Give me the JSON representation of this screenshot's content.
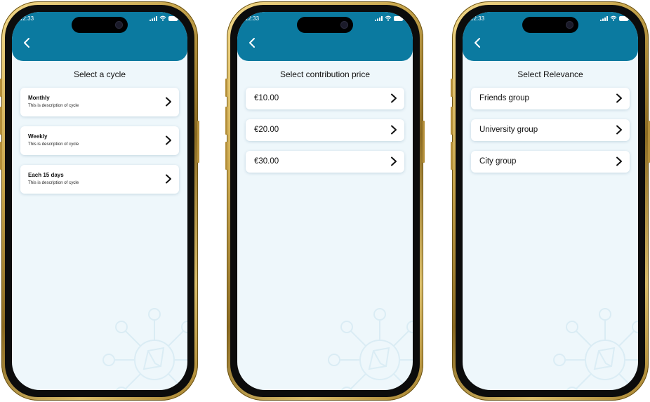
{
  "status": {
    "time": "12:33"
  },
  "screens": [
    {
      "title": "Select a cycle",
      "items": [
        {
          "title": "Monthly",
          "description": "This is description of cycle"
        },
        {
          "title": "Weekly",
          "description": "This is description of cycle"
        },
        {
          "title": "Each 15 days",
          "description": "This is description of cycle"
        }
      ]
    },
    {
      "title": "Select contribution price",
      "items": [
        {
          "label": "€10.00"
        },
        {
          "label": "€20.00"
        },
        {
          "label": "€30.00"
        }
      ]
    },
    {
      "title": "Select Relevance",
      "items": [
        {
          "label": "Friends group"
        },
        {
          "label": "University group"
        },
        {
          "label": "City group"
        }
      ]
    }
  ],
  "colors": {
    "header": "#0b7aa0",
    "background": "#eef7fb",
    "card": "#ffffff",
    "frame": "#c9a74e"
  },
  "icons": {
    "back": "chevron-left-icon",
    "row": "chevron-right-icon",
    "watermark": "network-logo-icon"
  }
}
